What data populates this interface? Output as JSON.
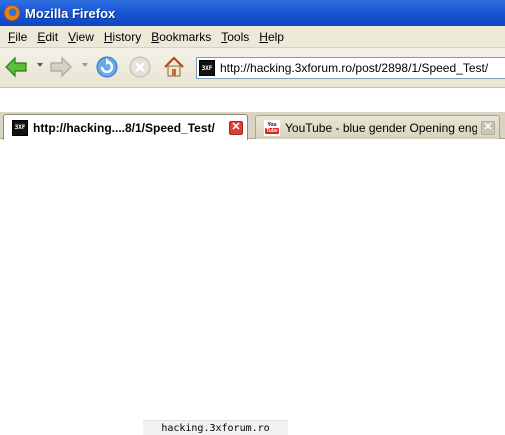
{
  "window": {
    "title": "Mozilla Firefox"
  },
  "menu": {
    "items": [
      {
        "accel": "F",
        "rest": "ile"
      },
      {
        "accel": "E",
        "rest": "dit"
      },
      {
        "accel": "V",
        "rest": "iew"
      },
      {
        "accel": "H",
        "rest": "istory"
      },
      {
        "accel": "B",
        "rest": "ookmarks"
      },
      {
        "accel": "T",
        "rest": "ools"
      },
      {
        "accel": "H",
        "rest": "elp"
      }
    ]
  },
  "navigation": {
    "url": "http://hacking.3xforum.ro/post/2898/1/Speed_Test/",
    "icons": [
      "back-arrow-icon",
      "forward-arrow-icon",
      "reload-icon",
      "stop-icon",
      "home-icon",
      "site-favicon-icon"
    ]
  },
  "tabs": [
    {
      "label": "http://hacking....8/1/Speed_Test/",
      "icon": "3xforum-favicon-icon",
      "active": true
    },
    {
      "label": "YouTube - blue gender Opening english",
      "icon": "youtube-favicon-icon",
      "active": false
    }
  ],
  "favicons": {
    "site_top": "3X",
    "site_bottom": "F",
    "youtube_top": "You",
    "youtube_bottom": "Tube"
  },
  "status": {
    "text": "hacking.3xforum.ro"
  },
  "colors": {
    "titlebar": "#1a58d6",
    "chrome": "#ece9d8",
    "close_active": "#d9413a",
    "back_arrow": "#3c9c2c"
  }
}
